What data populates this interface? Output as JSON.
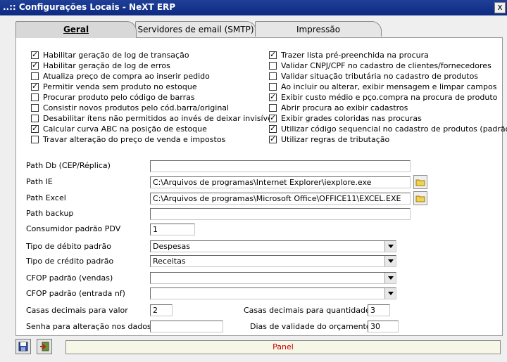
{
  "window": {
    "title": "..:: Configurações Locais - NeXT ERP",
    "close_label": "x"
  },
  "tabs": [
    {
      "label": "Geral",
      "active": true
    },
    {
      "label": "Servidores de email (SMTP)",
      "active": false
    },
    {
      "label": "Impressão",
      "active": false
    }
  ],
  "options_left": [
    {
      "label": "Habilitar geração de log de transação",
      "checked": true
    },
    {
      "label": "Habilitar geração de log de erros",
      "checked": true
    },
    {
      "label": "Atualiza preço de compra ao inserir pedido",
      "checked": false
    },
    {
      "label": "Permitir venda sem produto no estoque",
      "checked": true
    },
    {
      "label": "Procurar produto pelo código de barras",
      "checked": false
    },
    {
      "label": "Consistir novos produtos pelo cód.barra/original",
      "checked": false
    },
    {
      "label": "Desabilitar ítens não permitidos ao invés de deixar invisível",
      "checked": false
    },
    {
      "label": "Calcular curva ABC na posição de estoque",
      "checked": true
    },
    {
      "label": "Travar alteração do preço de venda e impostos",
      "checked": false
    }
  ],
  "options_right": [
    {
      "label": "Trazer lista pré-preenchida na procura",
      "checked": true
    },
    {
      "label": "Validar CNPJ/CPF no cadastro de clientes/fornecedores",
      "checked": false
    },
    {
      "label": "Validar situação tributária no cadastro de produtos",
      "checked": false
    },
    {
      "label": "Ao incluir ou alterar, exibir mensagem e limpar campos",
      "checked": false
    },
    {
      "label": "Exibir custo médio e pço.compra na procura de produto",
      "checked": true
    },
    {
      "label": "Abrir procura ao exibir cadastros",
      "checked": false
    },
    {
      "label": "Exibir grades coloridas nas procuras",
      "checked": true
    },
    {
      "label": "Utilizar código sequencial no cadastro de produtos (padrão)",
      "checked": true
    },
    {
      "label": "Utilizar regras de tributação",
      "checked": true
    }
  ],
  "fields": {
    "path_db": {
      "label": "Path Db (CEP/Réplica)",
      "value": ""
    },
    "path_ie": {
      "label": "Path IE",
      "value": "C:\\Arquivos de programas\\Internet Explorer\\iexplore.exe"
    },
    "path_excel": {
      "label": "Path Excel",
      "value": "C:\\Arquivos de programas\\Microsoft Office\\OFFICE11\\EXCEL.EXE"
    },
    "path_backup": {
      "label": "Path backup",
      "value": ""
    },
    "consumidor": {
      "label": "Consumidor padrão PDV",
      "value": "1"
    },
    "tipo_debito": {
      "label": "Tipo de débito padrão",
      "value": "Despesas"
    },
    "tipo_credito": {
      "label": "Tipo de crédito padrão",
      "value": "Receitas"
    },
    "cfop_vendas": {
      "label": "CFOP padrão (vendas)",
      "value": ""
    },
    "cfop_entrada": {
      "label": "CFOP padrão (entrada nf)",
      "value": ""
    },
    "casas_valor": {
      "label": "Casas decimais para valor",
      "value": "2"
    },
    "casas_qtd": {
      "label": "Casas decimais para quantidade",
      "value": "3"
    },
    "senha": {
      "label": "Senha para alteração nos dados",
      "value": ""
    },
    "validade": {
      "label": "Dias de validade do orçamento",
      "value": "30"
    }
  },
  "status": {
    "panel_label": "Panel"
  },
  "icons": {
    "save": "save-icon",
    "exit": "exit-icon",
    "folder": "folder-icon",
    "dropdown": "chevron-down-icon"
  },
  "colors": {
    "titlebar": "#0e2a82",
    "status_text": "#cc0000"
  }
}
